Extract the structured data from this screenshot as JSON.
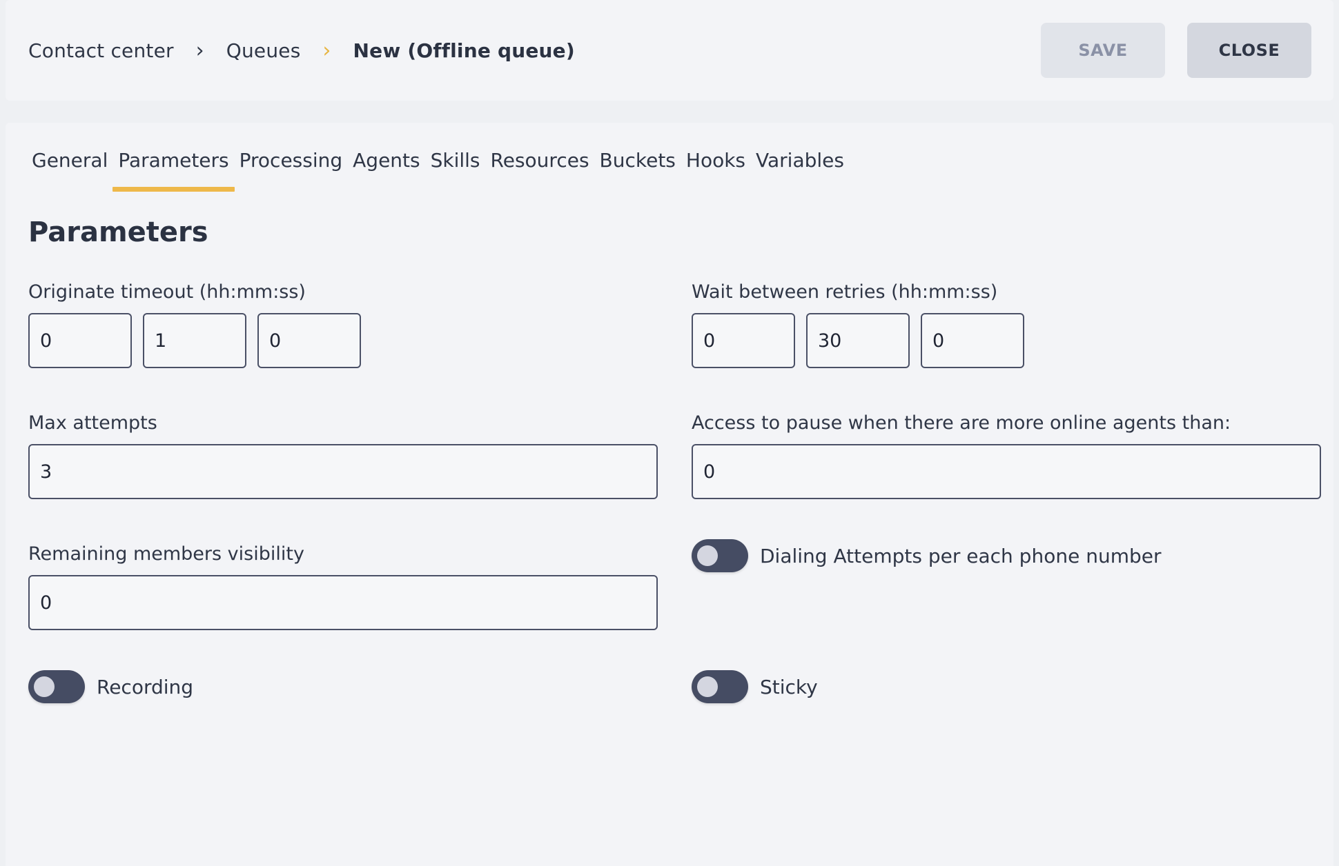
{
  "breadcrumb": {
    "items": [
      "Contact center",
      "Queues"
    ],
    "current": "New (Offline queue)"
  },
  "actions": {
    "save_label": "SAVE",
    "close_label": "CLOSE"
  },
  "tabs": [
    {
      "label": "General"
    },
    {
      "label": "Parameters",
      "active": true
    },
    {
      "label": "Processing"
    },
    {
      "label": "Agents"
    },
    {
      "label": "Skills"
    },
    {
      "label": "Resources"
    },
    {
      "label": "Buckets"
    },
    {
      "label": "Hooks"
    },
    {
      "label": "Variables"
    }
  ],
  "section_title": "Parameters",
  "originate_timeout": {
    "label": "Originate timeout (hh:mm:ss)",
    "hh": "0",
    "mm": "1",
    "ss": "0"
  },
  "wait_between_retries": {
    "label": "Wait between retries (hh:mm:ss)",
    "hh": "0",
    "mm": "30",
    "ss": "0"
  },
  "max_attempts": {
    "label": "Max attempts",
    "value": "3"
  },
  "access_to_pause": {
    "label": "Access to pause when there are more online agents than:",
    "value": "0"
  },
  "remaining_members_visibility": {
    "label": "Remaining members visibility",
    "value": "0"
  },
  "dialing_attempts_toggle": {
    "label": "Dialing Attempts per each phone number",
    "on": false
  },
  "recording_toggle": {
    "label": "Recording",
    "on": false
  },
  "sticky_toggle": {
    "label": "Sticky",
    "on": false
  },
  "colors": {
    "accent": "#eeb84a",
    "toggle_track": "#454c63",
    "panel_bg": "#f3f4f7"
  }
}
